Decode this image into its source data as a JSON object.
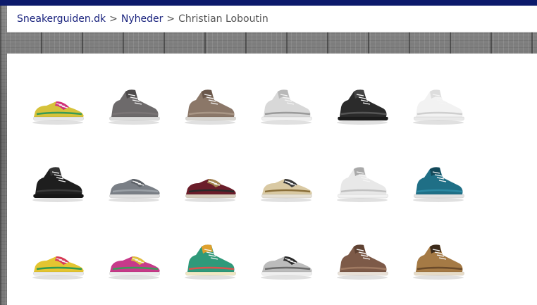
{
  "breadcrumb": {
    "home": "Sneakerguiden.dk",
    "sep1": ">",
    "section": "Nyheder",
    "sep2": ">",
    "current": "Christian Loboutin"
  },
  "colors": {
    "topbar": "#0c1a6b",
    "link": "#1a237e"
  },
  "gallery": [
    {
      "name": "multicolor-low",
      "style": "low",
      "upper": "#d6c23a",
      "accent": "#d1307a",
      "sole": "#e8e8e8",
      "trim": "#3a9a55"
    },
    {
      "name": "grey-high",
      "style": "high",
      "upper": "#6d6a6b",
      "accent": "#4d4a4b",
      "sole": "#dcdcdc",
      "trim": "#7a7576"
    },
    {
      "name": "taupe-spiked-high",
      "style": "high",
      "upper": "#8b7768",
      "accent": "#6a574b",
      "sole": "#d9d6d1",
      "trim": "#a99685"
    },
    {
      "name": "white-spiked-high",
      "style": "high",
      "upper": "#d8d8d8",
      "accent": "#b8b8b8",
      "sole": "#f0f0f0",
      "trim": "#9a9a9a"
    },
    {
      "name": "black-spiked-high",
      "style": "high",
      "upper": "#2b2b2b",
      "accent": "#444444",
      "sole": "#1c1c1c",
      "trim": "#555555"
    },
    {
      "name": "white-high",
      "style": "high",
      "upper": "#f2f2f2",
      "accent": "#dddddd",
      "sole": "#e9e9e9",
      "trim": "#cfcfcf"
    },
    {
      "name": "black-leather-high",
      "style": "high",
      "upper": "#1e1e1e",
      "accent": "#333333",
      "sole": "#161616",
      "trim": "#3a3a3a"
    },
    {
      "name": "grey-low",
      "style": "low",
      "upper": "#7a7f86",
      "accent": "#5b6066",
      "sole": "#e0e0e0",
      "trim": "#9aa0a6"
    },
    {
      "name": "burgundy-leopard-low",
      "style": "low",
      "upper": "#6b1d2a",
      "accent": "#a3854f",
      "sole": "#d8d0c0",
      "trim": "#2a2a2a"
    },
    {
      "name": "stripe-spiked-low",
      "style": "low",
      "upper": "#d9c9a3",
      "accent": "#3a3a3a",
      "sole": "#e6e1d6",
      "trim": "#8a6f3a"
    },
    {
      "name": "white-silver-spiked-high",
      "style": "high",
      "upper": "#e8e8e8",
      "accent": "#a9a9a9",
      "sole": "#f1f1f1",
      "trim": "#c0c0c0"
    },
    {
      "name": "teal-spiked-high",
      "style": "high",
      "upper": "#1f6f86",
      "accent": "#13495a",
      "sole": "#e2e2e2",
      "trim": "#2c89a3"
    },
    {
      "name": "multicolor-low-2",
      "style": "low",
      "upper": "#e4c531",
      "accent": "#d73a5a",
      "sole": "#eaeaea",
      "trim": "#2f9a4f"
    },
    {
      "name": "multicolor-low-3",
      "style": "low",
      "upper": "#c73a8a",
      "accent": "#e0c13b",
      "sole": "#ececec",
      "trim": "#3d9a5a"
    },
    {
      "name": "green-floral-high",
      "style": "high",
      "upper": "#2f9a7a",
      "accent": "#e0a12e",
      "sole": "#efe8c4",
      "trim": "#d9534f"
    },
    {
      "name": "black-grey-low",
      "style": "low",
      "upper": "#bcbcbc",
      "accent": "#2a2a2a",
      "sole": "#f0f0f0",
      "trim": "#6b6b6b"
    },
    {
      "name": "brown-suede-high",
      "style": "high",
      "upper": "#7d5a48",
      "accent": "#5f4233",
      "sole": "#e9e1d8",
      "trim": "#a07a62"
    },
    {
      "name": "leopard-high",
      "style": "high",
      "upper": "#a57a45",
      "accent": "#3b2a1a",
      "sole": "#e7dcc8",
      "trim": "#6a4a2a"
    }
  ]
}
